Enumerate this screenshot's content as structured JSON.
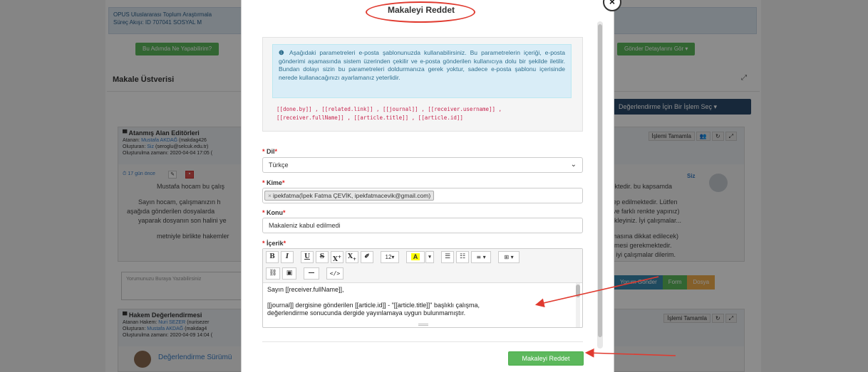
{
  "background": {
    "info_line1": "OPUS Uluslararası Toplum Araştırmala",
    "info_line2": "Süreç Akışı: ID 707041 SOSYAL M",
    "what_can_i_do_button": "Bu Adımda Ne Yapabilirim?",
    "show_details_button": "Gönder Detaylarını Gör ▾",
    "section_title": "Makale Üstverisi",
    "select_action_button": "Değerlendirme İçin Bir İşlem Seç ▾",
    "panel1": {
      "title": "Atanmış Alan Editörleri",
      "assigned_label": "Atanan:",
      "assigned_name": "Mustafa AKDAĞ",
      "assigned_email": "(makdag426",
      "created_by_label": "Oluşturan:",
      "created_by_name": "Siz",
      "created_by_email": "(seroglu@selcuk.edu.tr)",
      "created_time": "Oluşturulma zamanı: 2020-04-04 17:05 (",
      "complete_button": "İşlemi Tamamla",
      "time_ago": "17 gün önce",
      "author": "Siz",
      "lines_left": [
        "Mustafa hocam bu çalış",
        "Sayın hocam, çalışmanızın h",
        "aşağıda gönderilen dosyalarda",
        "yaparak dosyanın son halini ye",
        "metniyle birlikte hakemler"
      ],
      "lines_right": [
        "mektedir. bu kapsamda",
        "lep edilmektedir. Lütfen",
        "ve farklı renkte yapınız)",
        "kleyiniz. İyi çalışmalar...",
        "masına dikkat edilecek)",
        "erilmesi gerekmektedir.",
        "er iyi çalışmalar dilerim."
      ]
    },
    "comment_placeholder": "Yorumunuzu Buraya Yazabilirsiniz",
    "send_comment_button": "Yorum Gönder",
    "form_button": "Form",
    "file_button": "Dosya",
    "panel2": {
      "title": "Hakem Değerlendirmesi",
      "assigned_label": "Atanan Hakem:",
      "assigned_name": "Nuri SEZER",
      "assigned_email": "(nurisezer",
      "created_by_label": "Oluşturan:",
      "created_by_name": "Mustafa AKDAĞ",
      "created_by_email": "(makdag4",
      "created_time": "Oluşturulma zamanı: 2020-04-09 14:04 (",
      "complete_button": "İşlemi Tamamla",
      "version_link": "Değerlendirme Sürümü"
    }
  },
  "modal": {
    "title": "Makaleyi Reddet",
    "close_symbol": "×",
    "alert_icon": "info-circle-icon",
    "alert_text": "Aşağıdaki parametreleri e-posta şablonunuzda kullanabilirsiniz. Bu parametrelerin içeriği, e-posta gönderimi aşamasında sistem üzerinden çekilir ve e-posta gönderilen kullanıcıya dolu bir şekilde iletilir. Bundan dolayı sizin bu parametreleri doldurmanıza gerek yoktur, sadece e-posta şablonu içerisinde nerede kullanacağınızı ayarlamanız yeterlidir.",
    "params_line1": "[[done.by]] , [[related.link]] , [[journal]] , [[receiver.username]] ,",
    "params_line2": "[[receiver.fullName]] , [[article.title]] , [[article.id]]",
    "language": {
      "label": "Dil",
      "required": "*",
      "value": "Türkçe"
    },
    "to": {
      "label": "Kime",
      "required": "*",
      "tag_remove": "×",
      "tag_value": "ipekfatma(İpek Fatma ÇEVİK, ipekfatmacevik@gmail.com)"
    },
    "subject": {
      "label": "Konu",
      "required": "*",
      "value": "Makaleniz kabul edilmedi"
    },
    "content": {
      "label": "İçerik",
      "required": "*",
      "toolbar": {
        "bold": "B",
        "italic": "I",
        "underline": "U",
        "strike": "S",
        "superscript": "X",
        "sup_mark": "+",
        "subscript": "X",
        "sub_mark": "+",
        "eraser": "✐",
        "font_size": "12▾",
        "color": "A",
        "color_drop": "▾",
        "ul": "☰",
        "ol": "☷",
        "align": "≡ ▾",
        "table": "⊞ ▾",
        "link": "⛓",
        "image": "▣",
        "hr": "—",
        "code": "</>"
      },
      "line1": "Sayın [[receiver.fullName]],",
      "line2": "[[journal]] dergisine gönderilen [[article.id]] - \"[[article.title]]\" başlıklı çalışma,",
      "line3": "değerlendirme sonucunda dergide yayınlamaya uygun bulunmamıştır."
    },
    "submit_button": "Makaleyi Reddet"
  },
  "colors": {
    "accent_red": "#e03a2f",
    "success_green": "#5cb85c",
    "info_blue": "#d9edf7",
    "code_red": "#c7254e",
    "dark_blue": "#2a4a6b"
  }
}
